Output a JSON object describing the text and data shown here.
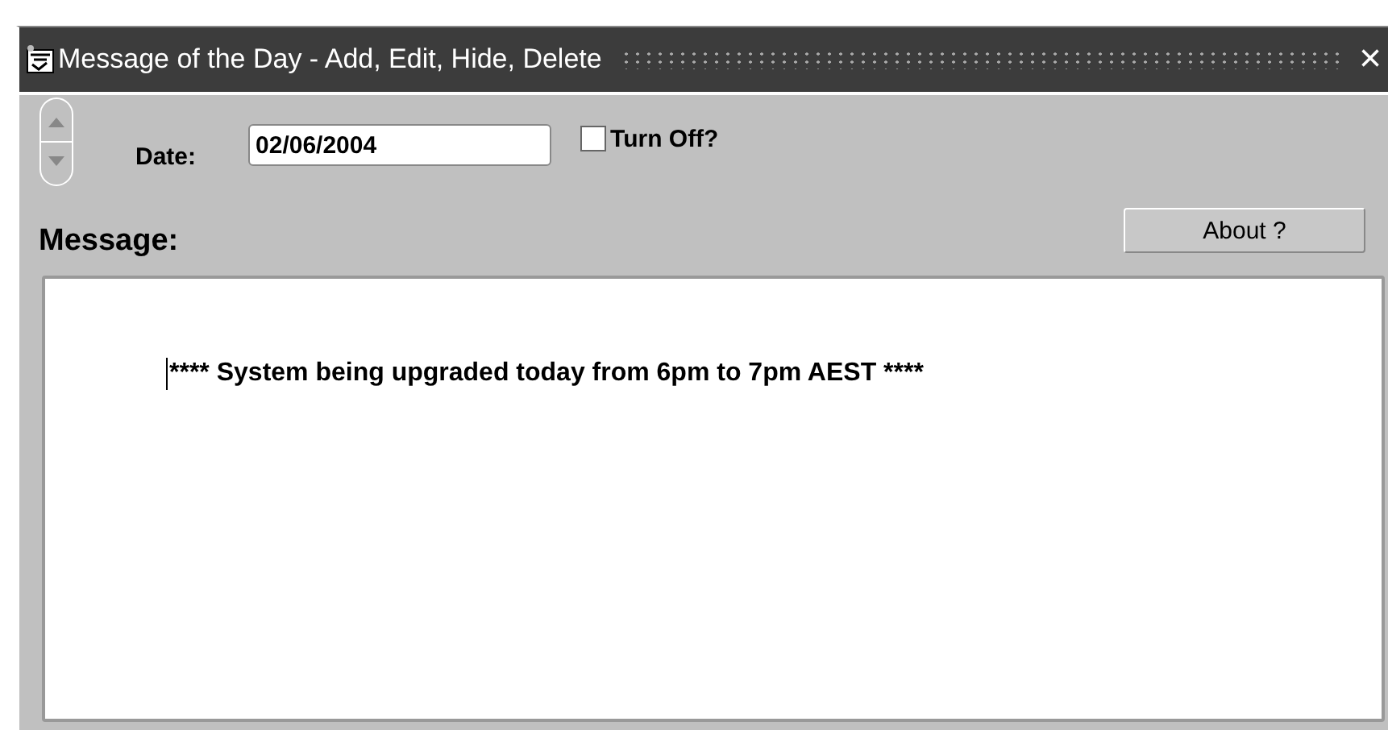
{
  "window": {
    "title": "Message of the Day - Add, Edit, Hide, Delete",
    "close": "×"
  },
  "date": {
    "label": "Date:",
    "value": "02/06/2004"
  },
  "turn_off": {
    "label": "Turn Off?",
    "checked": false
  },
  "message": {
    "label": "Message:",
    "text": "**** System being upgraded today from 6pm to 7pm AEST ****"
  },
  "buttons": [
    {
      "label": "About ?"
    }
  ]
}
